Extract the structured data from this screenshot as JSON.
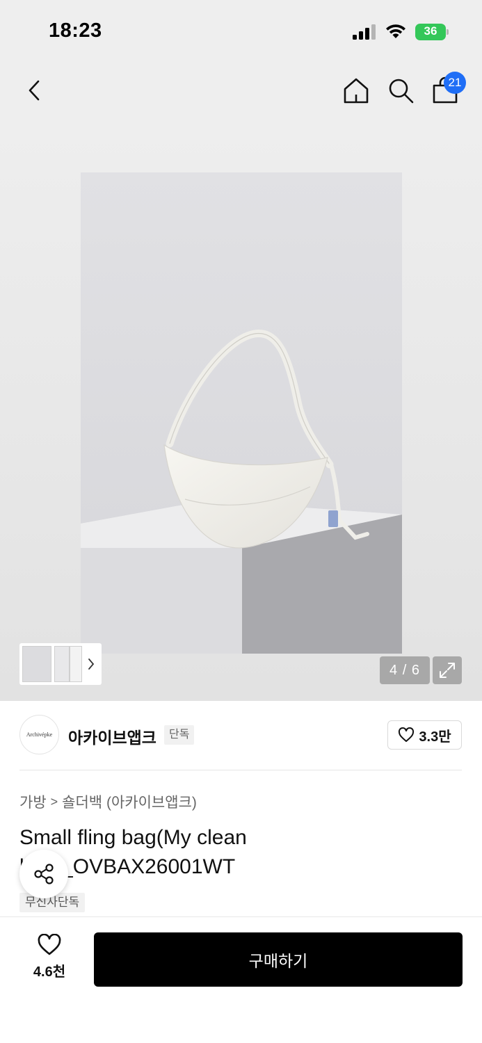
{
  "status_bar": {
    "time": "18:23",
    "battery": "36"
  },
  "nav": {
    "cart_count": "21"
  },
  "gallery": {
    "counter": "4 / 6"
  },
  "brand": {
    "logo_text": "Archivépke",
    "name": "아카이브앱크",
    "tag": "단독",
    "likes": "3.3만"
  },
  "product": {
    "breadcrumb": {
      "category": "가방",
      "separator": ">",
      "subcategory": "숄더백 (아카이브앱크)"
    },
    "title": "Small fling bag(My clean bed)_OVBAX26001WT",
    "exclusive_tag": "무신사단독"
  },
  "bottom_bar": {
    "like_count": "4.6천",
    "buy_label": "구매하기"
  }
}
